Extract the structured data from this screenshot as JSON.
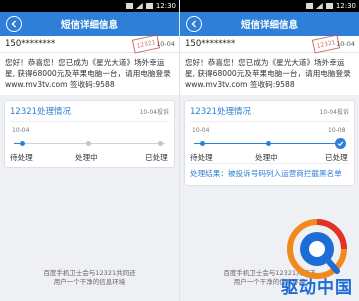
{
  "status": {
    "time": "12:30"
  },
  "header": {
    "title": "短信详细信息"
  },
  "message": {
    "sender": "150********",
    "stamp": "12321",
    "date": "10-04",
    "body": "您好！恭喜您！您已成为《星光大道》场外幸运星, 获得68000元及苹果电脑一台，请用电脑登录 www.mv3tv.com   签收码:9588"
  },
  "left": {
    "report": {
      "title": "12321处理情况",
      "meta": "10-04投诉",
      "step_time": "10-04",
      "steps": [
        "待处理",
        "处理中",
        "已处理"
      ]
    }
  },
  "right": {
    "report": {
      "title": "12321处理情况",
      "meta": "10-04投诉",
      "step_time_start": "10-04",
      "step_time_end": "10-08",
      "steps": [
        "待处理",
        "处理中",
        "已处理"
      ],
      "result": "处理结果：被投诉号码列入运营商拦截黑名单"
    }
  },
  "footer": {
    "line1": "百度手机卫士会与12321共同还",
    "line2": "用户一个干净的信息环境"
  },
  "watermark": {
    "text": "驱动中国"
  },
  "colors": {
    "accent": "#2e7fd8",
    "stamp": "#c9564e",
    "background": "#eef0f3"
  }
}
